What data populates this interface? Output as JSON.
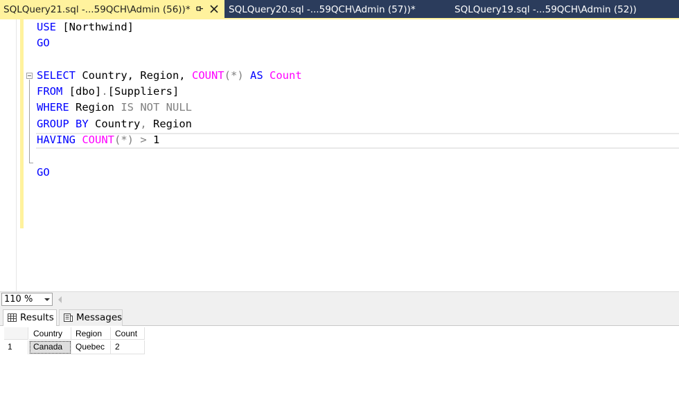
{
  "tabs": [
    {
      "label": "SQLQuery21.sql -...59QCH\\Admin (56))*",
      "active": true
    },
    {
      "label": "SQLQuery20.sql -...59QCH\\Admin (57))*",
      "active": false
    },
    {
      "label": "SQLQuery19.sql -...59QCH\\Admin (52))",
      "active": false
    }
  ],
  "editor": {
    "line1": {
      "kw": "USE",
      "rest": " [Northwind]"
    },
    "line2": {
      "kw": "GO"
    },
    "line4": {
      "kw1": "SELECT",
      "t1": " Country, Region, ",
      "fn1": "COUNT",
      "g1": "(*)",
      "t2": " ",
      "kw2": "AS",
      "t3": " ",
      "fn2": "Count"
    },
    "line5": {
      "kw": "FROM",
      "t1": " [dbo]",
      "g1": ".",
      "t2": "[Suppliers]"
    },
    "line6": {
      "kw": "WHERE",
      "t1": " Region ",
      "g1": "IS NOT NULL"
    },
    "line7": {
      "kw": "GROUP BY",
      "t1": " Country",
      "g1": ",",
      "t2": " Region"
    },
    "line8": {
      "kw": "HAVING",
      "t1": " ",
      "fn1": "COUNT",
      "g1": "(*)",
      "t2": " ",
      "g2": ">",
      "t3": " 1"
    },
    "line10": {
      "kw": "GO"
    }
  },
  "zoom": {
    "value": "110 %"
  },
  "result_tabs": {
    "results": "Results",
    "messages": "Messages"
  },
  "grid": {
    "columns": [
      "Country",
      "Region",
      "Count"
    ],
    "rows": [
      {
        "num": "1",
        "cells": [
          "Canada",
          "Quebec",
          "2"
        ]
      }
    ]
  },
  "colors": {
    "tab_bg": "#2b3c5c",
    "active_tab": "#fff29d",
    "keyword": "#0000ff",
    "function": "#ff00ff",
    "operator": "#808080"
  },
  "icons": {
    "pin": "pin-icon",
    "close": "close-icon",
    "results": "grid-icon",
    "messages": "messages-icon"
  }
}
